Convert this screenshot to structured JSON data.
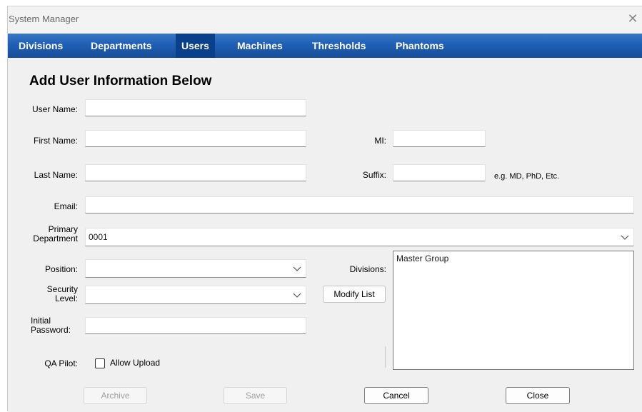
{
  "window": {
    "title": "System Manager",
    "close_glyph": "✕"
  },
  "tabs": [
    {
      "label": "Divisions",
      "active": false
    },
    {
      "label": "Departments",
      "active": false
    },
    {
      "label": "Users",
      "active": true
    },
    {
      "label": "Machines",
      "active": false
    },
    {
      "label": "Thresholds",
      "active": false
    },
    {
      "label": "Phantoms",
      "active": false
    }
  ],
  "form": {
    "heading": "Add User Information Below",
    "user_name_label": "User Name:",
    "first_name_label": "First Name:",
    "last_name_label": "Last Name:",
    "email_label": "Email:",
    "primary_department_label_1": "Primary",
    "primary_department_label_2": "Department",
    "primary_department_value": "0001",
    "position_label": "Position:",
    "security_level_label_1": "Security",
    "security_level_label_2": "Level:",
    "initial_password_label_1": "Initial",
    "initial_password_label_2": "Password:",
    "qa_pilot_label": "QA Pilot:",
    "allow_upload_label": "Allow Upload",
    "mi_label": "MI:",
    "suffix_label": "Suffix:",
    "suffix_hint": "e.g. MD, PhD, Etc.",
    "divisions_label": "Divisions:",
    "modify_list_label": "Modify List",
    "divisions_items": [
      "Master Group"
    ]
  },
  "footer": {
    "archive_label": "Archive",
    "save_label": "Save",
    "cancel_label": "Cancel",
    "close_label": "Close"
  }
}
